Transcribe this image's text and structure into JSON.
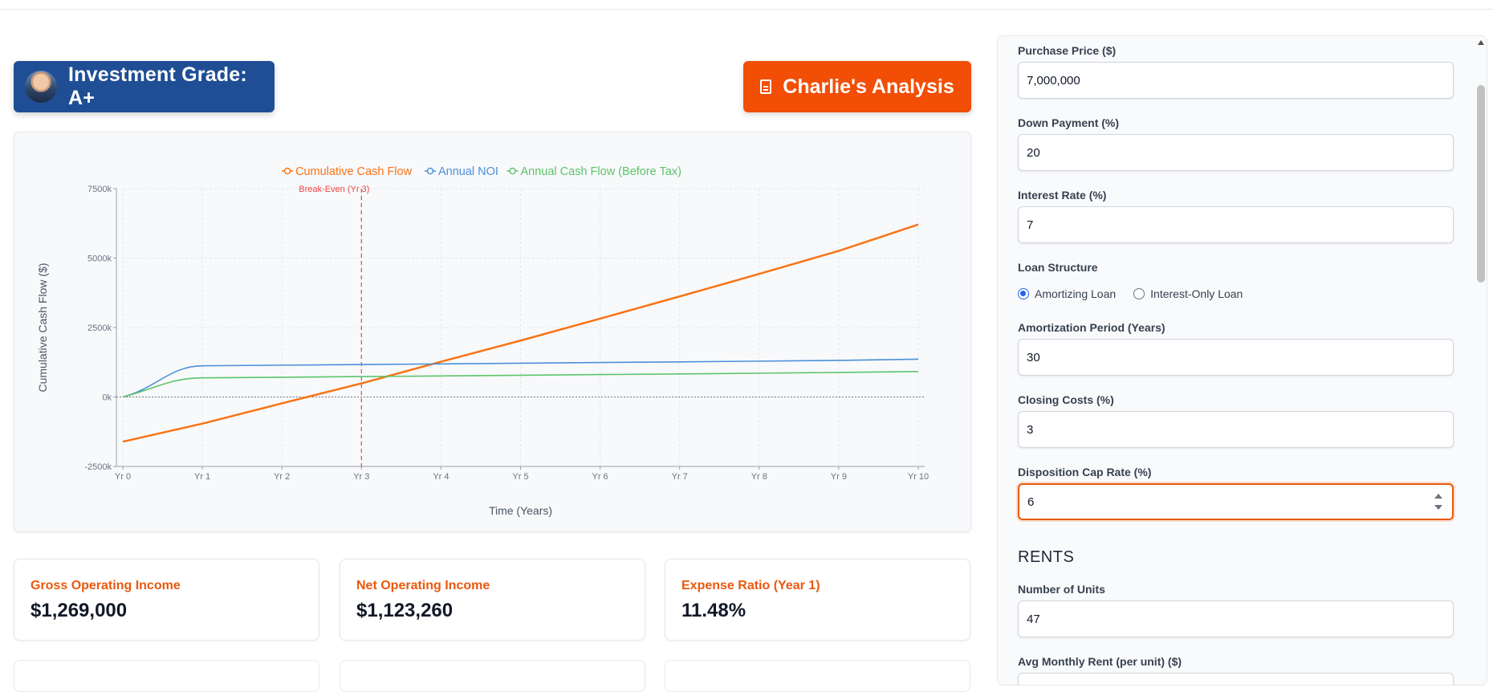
{
  "header": {
    "grade_label": "Investment Grade: A+",
    "analysis_button": "Charlie's Analysis"
  },
  "chart_data": {
    "type": "line",
    "xlabel": "Time (Years)",
    "ylabel": "Cumulative Cash Flow ($)",
    "x": [
      "Yr 0",
      "Yr 1",
      "Yr 2",
      "Yr 3",
      "Yr 4",
      "Yr 5",
      "Yr 6",
      "Yr 7",
      "Yr 8",
      "Yr 9",
      "Yr 10"
    ],
    "ylim": [
      -2500,
      7500
    ],
    "yticks": [
      "7500k",
      "5000k",
      "2500k",
      "0k",
      "-2500k"
    ],
    "ytick_values": [
      7500,
      5000,
      2500,
      0,
      -2500
    ],
    "grid": true,
    "legend_position": "top-center",
    "annotation": {
      "label": "Break-Even (Yr 3)",
      "x_index": 3
    },
    "series": [
      {
        "name": "Cumulative Cash Flow",
        "color": "#f97316",
        "values": [
          -1610,
          -960,
          -230,
          490,
          1270,
          2030,
          2820,
          3620,
          4430,
          5260,
          6210
        ]
      },
      {
        "name": "Annual NOI",
        "color": "#4a90d9",
        "values": [
          0,
          1123,
          1145,
          1168,
          1191,
          1215,
          1240,
          1264,
          1290,
          1316,
          1360
        ]
      },
      {
        "name": "Annual Cash Flow (Before Tax)",
        "color": "#5cc46b",
        "values": [
          0,
          689,
          711,
          734,
          757,
          781,
          806,
          830,
          856,
          882,
          915
        ]
      }
    ]
  },
  "stats": [
    {
      "label": "Gross Operating Income",
      "value": "$1,269,000"
    },
    {
      "label": "Net Operating Income",
      "value": "$1,123,260"
    },
    {
      "label": "Expense Ratio (Year 1)",
      "value": "11.48%"
    }
  ],
  "form": {
    "purchase_price": {
      "label": "Purchase Price ($)",
      "value": "7,000,000"
    },
    "down_payment": {
      "label": "Down Payment (%)",
      "value": "20"
    },
    "interest_rate": {
      "label": "Interest Rate (%)",
      "value": "7"
    },
    "loan_structure": {
      "label": "Loan Structure",
      "options": [
        "Amortizing Loan",
        "Interest-Only Loan"
      ],
      "selected": "Amortizing Loan"
    },
    "amortization": {
      "label": "Amortization Period (Years)",
      "value": "30"
    },
    "closing_costs": {
      "label": "Closing Costs (%)",
      "value": "3"
    },
    "disposition_cap": {
      "label": "Disposition Cap Rate (%)",
      "value": "6"
    },
    "rents_section": "RENTS",
    "units": {
      "label": "Number of Units",
      "value": "47"
    },
    "avg_rent": {
      "label": "Avg Monthly Rent (per unit) ($)"
    }
  }
}
